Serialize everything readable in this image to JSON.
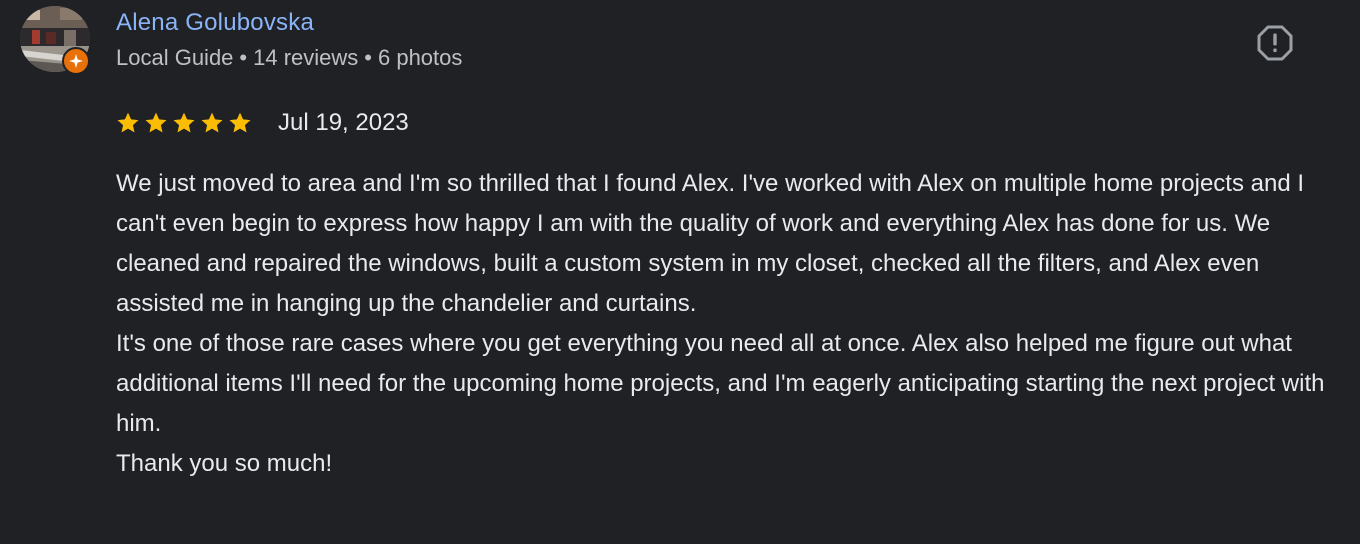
{
  "reviewer": {
    "name": "Alena Golubovska",
    "title": "Local Guide",
    "reviews_count": "14 reviews",
    "photos_count": "6 photos",
    "separator": "•"
  },
  "review": {
    "rating": 5,
    "max_rating": 5,
    "date": "Jul 19, 2023",
    "paragraphs": [
      "We just moved to area and I'm so thrilled that I found Alex. I've worked with Alex on multiple home projects and I can't even begin to express how happy I am with the quality of work and everything Alex has done for us. We cleaned and repaired the windows, built a custom system in my closet, checked all the filters, and Alex even assisted me in hanging up the chandelier and curtains.",
      "It's one of those rare cases where you get everything you need all at once. Alex also helped me figure out what additional items I'll need for the upcoming home projects, and I'm eagerly anticipating starting the next project with him.",
      "Thank you so much!"
    ]
  },
  "icons": {
    "report": "report-flag-icon",
    "star": "star-icon",
    "guide_badge": "local-guide-badge-icon",
    "avatar": "avatar"
  },
  "colors": {
    "background": "#202124",
    "name_link": "#8ab4f8",
    "meta_text": "#bdc1c6",
    "body_text": "#e8eaed",
    "star": "#fbbc04",
    "badge": "#e8710a",
    "report_icon": "#9aa0a6"
  }
}
